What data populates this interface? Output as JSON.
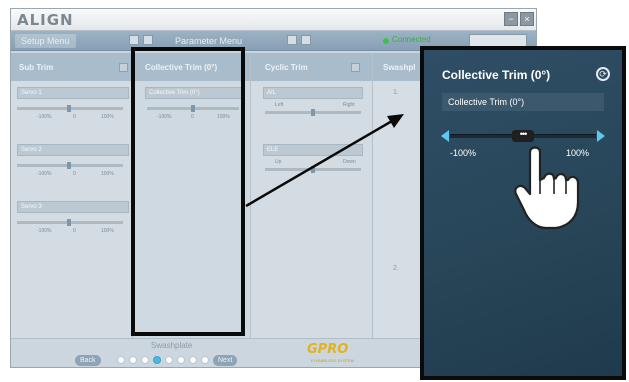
{
  "app": {
    "brand": "ALIGN",
    "window_buttons": [
      "−",
      "×"
    ],
    "tabs": [
      "Setup Menu",
      "Parameter Menu"
    ],
    "connection_status": "Connected"
  },
  "panels": {
    "sub_trim": {
      "title": "Sub Trim",
      "servos": [
        {
          "label": "Servo 1",
          "min": "-100%",
          "max": "100%",
          "mid": "0"
        },
        {
          "label": "Servo 2",
          "min": "-100%",
          "max": "100%",
          "mid": "0"
        },
        {
          "label": "Servo 3",
          "min": "-100%",
          "max": "100%",
          "mid": "0"
        }
      ]
    },
    "collective_trim": {
      "title": "Collective Trim (0°)",
      "field": "Collective Trim (0°)",
      "min": "-100%",
      "max": "100%",
      "mid": "0"
    },
    "cyclic_trim": {
      "title": "Cyclic Trim",
      "groups": [
        {
          "label": "AIL",
          "left": "Left",
          "right": "Right"
        },
        {
          "label": "ELE",
          "left": "Up",
          "right": "Down"
        }
      ]
    },
    "swashplate": {
      "title": "Swashpl",
      "steps": [
        "1.",
        "2."
      ]
    }
  },
  "bottom_nav": {
    "label": "Swashplate",
    "back": "Back",
    "next": "Next",
    "step_count": 8,
    "active_step_index": 3,
    "logo": "GPRO",
    "logo_sub": "FLYBARLESS SYSTEM"
  },
  "zoom_inset": {
    "title": "Collective Trim (0°)",
    "field": "Collective Trim (0°)",
    "slider_min_label": "-100%",
    "slider_max_label": "100%",
    "slider_value_fraction": 0.5,
    "thumb_glyph": "•••",
    "reset_icon": "refresh-icon"
  },
  "colors": {
    "inset_bg": "#2b4a60",
    "slider_arrow": "#5cc7f0",
    "gpro_gold": "#e2b21f",
    "connected_green": "#3fc04a"
  }
}
